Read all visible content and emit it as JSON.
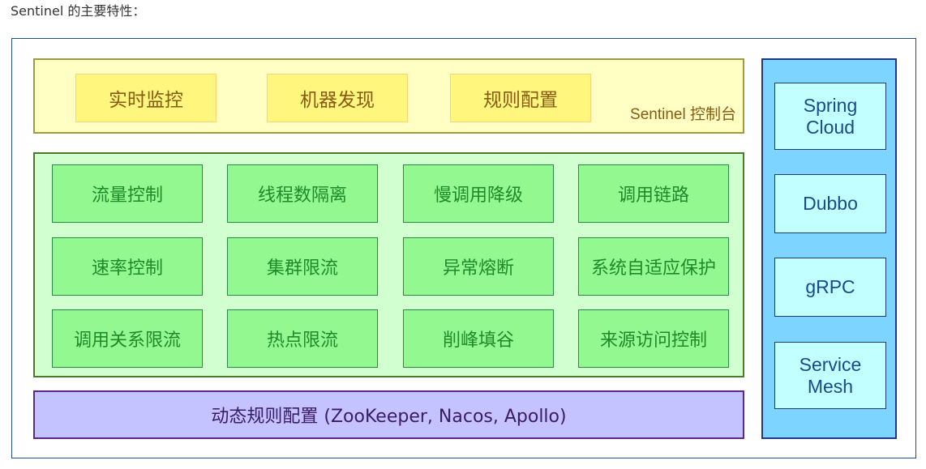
{
  "intro_text": "Sentinel 的主要特性：",
  "dashboard": {
    "label": "Sentinel 控制台",
    "items": [
      "实时监控",
      "机器发现",
      "规则配置"
    ]
  },
  "core_features": {
    "rows": [
      [
        "流量控制",
        "线程数隔离",
        "慢调用降级",
        "调用链路"
      ],
      [
        "速率控制",
        "集群限流",
        "异常熔断",
        "系统自适应保护"
      ],
      [
        "调用关系限流",
        "热点限流",
        "削峰填谷",
        "来源访问控制"
      ]
    ]
  },
  "dynamic_rules": {
    "label": "动态规则配置 (ZooKeeper, Nacos, Apollo)"
  },
  "adapters": {
    "items": [
      "Spring\nCloud",
      "Dubbo",
      "gRPC",
      "Service\nMesh"
    ]
  },
  "colors": {
    "frame_border": "#1f4e8c",
    "dashboard_bg": "#ffffc4",
    "dashboard_item_bg": "#fff67e",
    "dashboard_text": "#8a5a10",
    "core_bg": "#d2ffd0",
    "feature_bg": "#92f88f",
    "feature_text": "#1e8a2a",
    "dynamic_bg": "#c4c2ff",
    "dynamic_text": "#3a1a6a",
    "adapter_panel_bg": "#7dd4ff",
    "adapter_bg": "#c2ffff",
    "adapter_text": "#1a4a8a"
  }
}
